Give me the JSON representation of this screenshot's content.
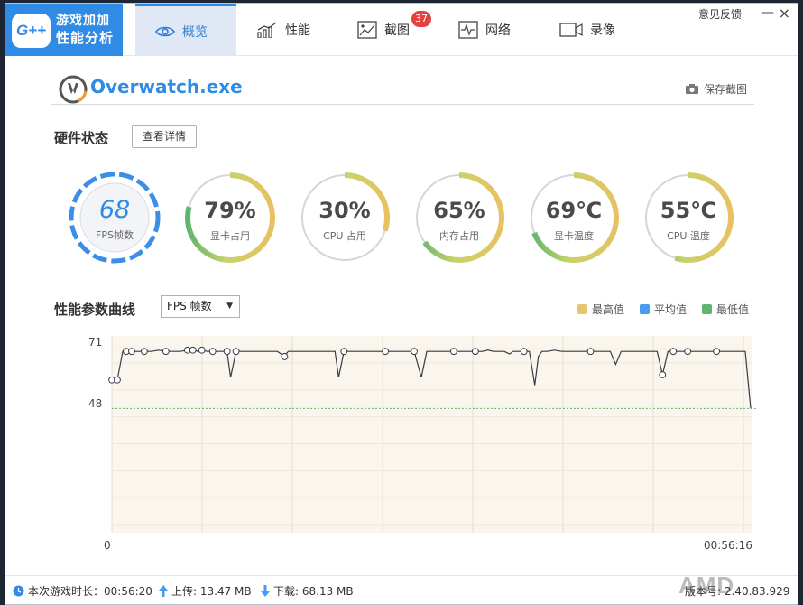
{
  "app": {
    "logo_line1": "游戏加加",
    "logo_line2": "性能分析",
    "logo_mark": "G++",
    "feedback": "意见反馈",
    "minimize": "—",
    "close": "×"
  },
  "nav": {
    "tabs": [
      {
        "label": "概览",
        "icon": "eye-icon",
        "active": true
      },
      {
        "label": "性能",
        "icon": "bar-chart-icon",
        "active": false
      },
      {
        "label": "截图",
        "icon": "picture-icon",
        "active": false,
        "badge": "37"
      },
      {
        "label": "网络",
        "icon": "pulse-icon",
        "active": false
      },
      {
        "label": "录像",
        "icon": "video-camera-icon",
        "active": false
      }
    ]
  },
  "process": {
    "name": "Overwatch.exe",
    "save_screenshot": "保存截图"
  },
  "hardware": {
    "title": "硬件状态",
    "detail_button": "查看详情",
    "gauges": [
      {
        "value": "68",
        "label": "FPS帧数",
        "percent": 1.0,
        "color": "#3b8ee8"
      },
      {
        "value": "79%",
        "label": "显卡占用",
        "percent": 0.79
      },
      {
        "value": "30%",
        "label": "CPU 占用",
        "percent": 0.3
      },
      {
        "value": "65%",
        "label": "内存占用",
        "percent": 0.65
      },
      {
        "value": "69℃",
        "label": "显卡温度",
        "percent": 0.69
      },
      {
        "value": "55℃",
        "label": "CPU 温度",
        "percent": 0.55
      }
    ]
  },
  "curve": {
    "title": "性能参数曲线",
    "select_value": "FPS 帧数",
    "legend": [
      {
        "label": "最高值",
        "color": "#e9c46a"
      },
      {
        "label": "平均值",
        "color": "#4a9bef"
      },
      {
        "label": "最低值",
        "color": "#5fb56e"
      }
    ]
  },
  "chart_data": {
    "type": "line",
    "ylabels": [
      "71",
      "48"
    ],
    "xlabels": [
      "0",
      "00:56:16"
    ],
    "max_value": 71,
    "min_value": 48,
    "y_range": [
      0,
      76
    ],
    "x_range": [
      0,
      100
    ],
    "series": [
      {
        "values": [
          [
            0,
            59
          ],
          [
            1.5,
            59
          ],
          [
            3,
            70
          ],
          [
            4,
            70
          ],
          [
            5.5,
            70
          ],
          [
            7,
            70
          ],
          [
            9,
            70
          ],
          [
            11,
            70
          ],
          [
            13,
            70.5
          ],
          [
            15,
            70
          ],
          [
            17,
            70
          ],
          [
            19,
            70
          ],
          [
            21,
            70.5
          ],
          [
            22.5,
            70.5
          ],
          [
            24,
            70
          ],
          [
            25,
            70.5
          ],
          [
            26.5,
            70
          ],
          [
            28,
            70
          ],
          [
            30,
            70
          ],
          [
            32,
            70
          ],
          [
            33,
            60
          ],
          [
            34.5,
            70
          ],
          [
            36,
            70
          ],
          [
            37.5,
            70
          ],
          [
            39,
            70
          ],
          [
            42,
            70
          ],
          [
            44,
            70
          ],
          [
            46,
            70
          ],
          [
            48,
            68
          ],
          [
            49,
            70
          ],
          [
            51,
            70
          ],
          [
            53,
            70
          ],
          [
            55,
            70
          ],
          [
            57,
            70
          ],
          [
            60,
            70
          ],
          [
            62,
            70
          ],
          [
            63,
            60
          ],
          [
            64.5,
            70
          ],
          [
            66,
            70
          ],
          [
            68,
            70
          ],
          [
            70,
            70
          ],
          [
            72,
            70
          ],
          [
            74,
            70
          ],
          [
            76,
            70
          ],
          [
            78,
            70
          ],
          [
            80,
            70
          ],
          [
            82,
            70
          ],
          [
            84,
            70
          ],
          [
            86,
            60
          ],
          [
            87.5,
            70
          ],
          [
            89,
            70
          ],
          [
            91,
            70
          ],
          [
            93,
            70
          ],
          [
            95,
            70
          ],
          [
            97,
            70
          ],
          [
            99,
            70
          ],
          [
            101,
            70
          ],
          [
            103,
            70
          ],
          [
            104.5,
            70.5
          ],
          [
            106,
            70
          ],
          [
            107.5,
            70
          ],
          [
            109,
            70
          ],
          [
            110.5,
            69
          ],
          [
            111.5,
            70
          ],
          [
            113,
            70
          ],
          [
            114.5,
            70
          ],
          [
            116,
            70
          ],
          [
            117.5,
            57
          ],
          [
            118.5,
            68
          ],
          [
            119.5,
            70
          ],
          [
            121,
            70
          ],
          [
            123,
            70.5
          ],
          [
            125,
            70
          ],
          [
            127,
            70
          ],
          [
            128.5,
            70
          ],
          [
            130,
            70
          ],
          [
            131.5,
            70
          ],
          [
            133,
            70
          ],
          [
            135,
            70
          ],
          [
            137,
            70
          ],
          [
            138.5,
            70
          ],
          [
            140,
            65
          ],
          [
            141.5,
            70
          ],
          [
            143,
            70
          ],
          [
            145,
            70
          ],
          [
            147,
            70
          ],
          [
            148,
            70
          ],
          [
            150,
            70
          ],
          [
            151.5,
            70
          ],
          [
            153,
            61
          ],
          [
            154.5,
            70
          ],
          [
            156,
            70
          ],
          [
            158,
            70
          ],
          [
            160,
            70
          ],
          [
            162,
            70
          ],
          [
            164,
            70
          ],
          [
            166,
            70
          ],
          [
            168,
            70
          ],
          [
            170,
            70
          ],
          [
            172,
            70
          ],
          [
            174,
            70
          ],
          [
            176,
            70
          ],
          [
            177.5,
            48
          ]
        ]
      }
    ]
  },
  "status": {
    "duration_label": "本次游戏时长：00:56:20",
    "upload_label": "上传: 13.47 MB",
    "download_label": "下载: 68.13 MB",
    "version_label": "版本号: 2.40.83.929",
    "watermark": "AMD"
  }
}
